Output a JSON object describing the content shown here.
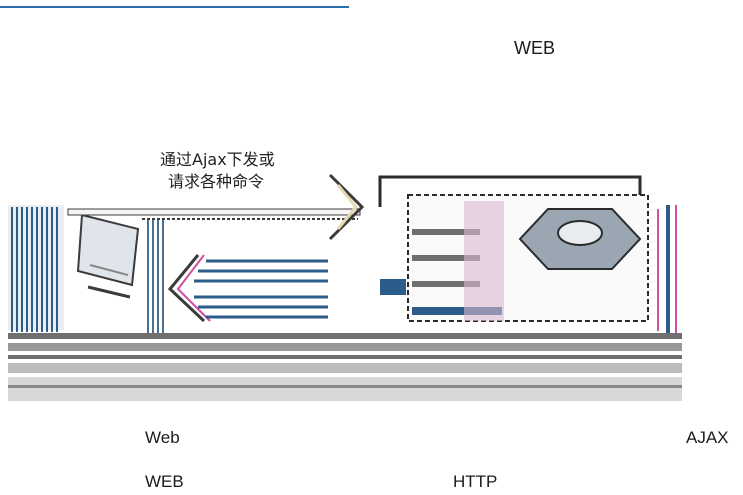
{
  "heading": "WEB",
  "figure": {
    "command_label_line1": "通过Ajax下发或",
    "command_label_line2": "请求各种命令",
    "colors": {
      "blue_stripe": "#2c5d8a",
      "magenta": "#d04fa0",
      "grey_band": "#6f6f6f",
      "hex_fill": "#9aa6b2"
    }
  },
  "captions": {
    "web": "Web",
    "ajax": "AJAX",
    "web2": "WEB",
    "http": "HTTP"
  }
}
